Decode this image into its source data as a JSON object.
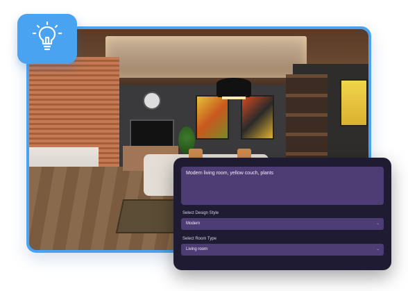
{
  "prompt": {
    "text": "Modern living room, yellow couch, plants"
  },
  "design_style": {
    "label": "Select Design Style",
    "value": "Modern"
  },
  "room_type": {
    "label": "Select Room Type",
    "value": "Living room"
  },
  "icons": {
    "badge": "lightbulb-icon",
    "dropdown": "chevron-down-icon"
  },
  "colors": {
    "accent_blue": "#4aa3f0",
    "panel_bg": "#1f1b33",
    "field_bg": "#4e3d74"
  }
}
